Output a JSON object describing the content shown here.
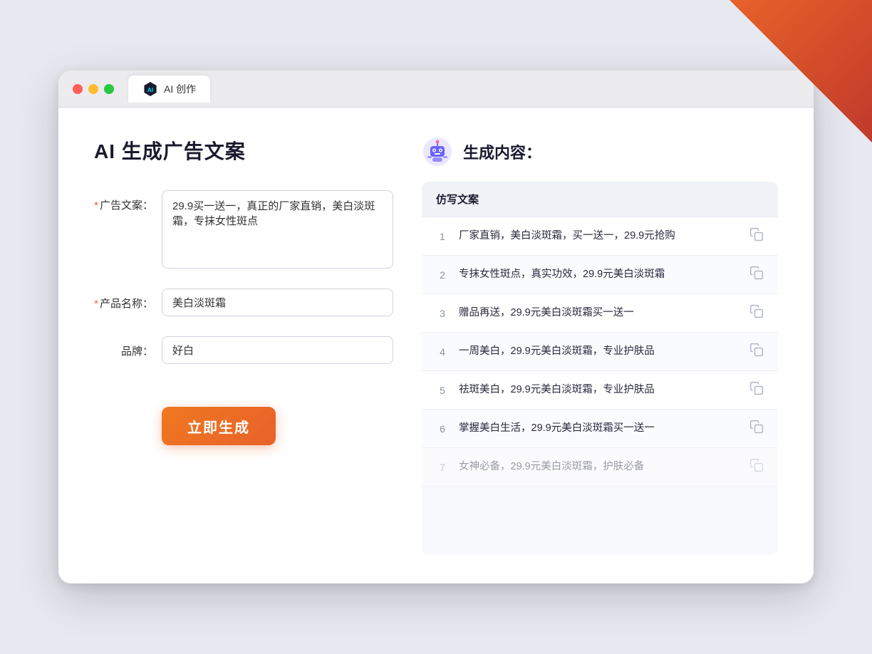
{
  "browser": {
    "tab_title": "AI 创作"
  },
  "page": {
    "title": "AI 生成广告文案",
    "right_title": "生成内容："
  },
  "form": {
    "ad_copy_label": "广告文案：",
    "ad_copy_required": "*",
    "ad_copy_value": "29.9买一送一，真正的厂家直销，美白淡斑霜，专抹女性斑点",
    "product_label": "产品名称：",
    "product_required": "*",
    "product_value": "美白淡斑霜",
    "brand_label": "品牌：",
    "brand_value": "好白",
    "generate_button": "立即生成"
  },
  "results": {
    "column_header": "仿写文案",
    "items": [
      {
        "num": "1",
        "text": "厂家直销，美白淡斑霜，买一送一，29.9元抢购",
        "dimmed": false
      },
      {
        "num": "2",
        "text": "专抹女性斑点，真实功效，29.9元美白淡斑霜",
        "dimmed": false
      },
      {
        "num": "3",
        "text": "赠品再送，29.9元美白淡斑霜买一送一",
        "dimmed": false
      },
      {
        "num": "4",
        "text": "一周美白，29.9元美白淡斑霜，专业护肤品",
        "dimmed": false
      },
      {
        "num": "5",
        "text": "祛斑美白，29.9元美白淡斑霜，专业护肤品",
        "dimmed": false
      },
      {
        "num": "6",
        "text": "掌握美白生活，29.9元美白淡斑霜买一送一",
        "dimmed": false
      },
      {
        "num": "7",
        "text": "女神必备，29.9元美白淡斑霜，护肤必备",
        "dimmed": true
      }
    ]
  }
}
